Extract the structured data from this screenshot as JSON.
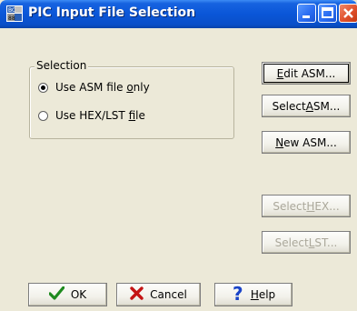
{
  "window": {
    "title": "PIC Input File Selection"
  },
  "selection": {
    "group_label": "Selection",
    "options": [
      {
        "label_pre": "Use ASM file ",
        "label_ul": "o",
        "label_post": "nly",
        "selected": true
      },
      {
        "label_pre": "Use HEX/LST ",
        "label_ul": "f",
        "label_post": "ile",
        "selected": false
      }
    ]
  },
  "side_buttons": [
    {
      "pre": "",
      "ul": "E",
      "post": "dit ASM...",
      "enabled": true
    },
    {
      "pre": "Select ",
      "ul": "A",
      "post": "SM...",
      "enabled": true
    },
    {
      "pre": "",
      "ul": "N",
      "post": "ew ASM...",
      "enabled": true
    },
    {
      "pre": "Select ",
      "ul": "H",
      "post": "EX...",
      "enabled": false
    },
    {
      "pre": "Select ",
      "ul": "L",
      "post": "ST...",
      "enabled": false
    }
  ],
  "footer": {
    "ok_label": "OK",
    "cancel_label": "Cancel",
    "help_ul": "H",
    "help_post": "elp"
  },
  "icons": {
    "ok": "green-checkmark-icon",
    "cancel": "red-x-icon",
    "help": "blue-question-icon"
  },
  "colors": {
    "title_bar": "#0a56d8",
    "dialog_bg": "#ece9d8",
    "close_button": "#e0502c"
  }
}
